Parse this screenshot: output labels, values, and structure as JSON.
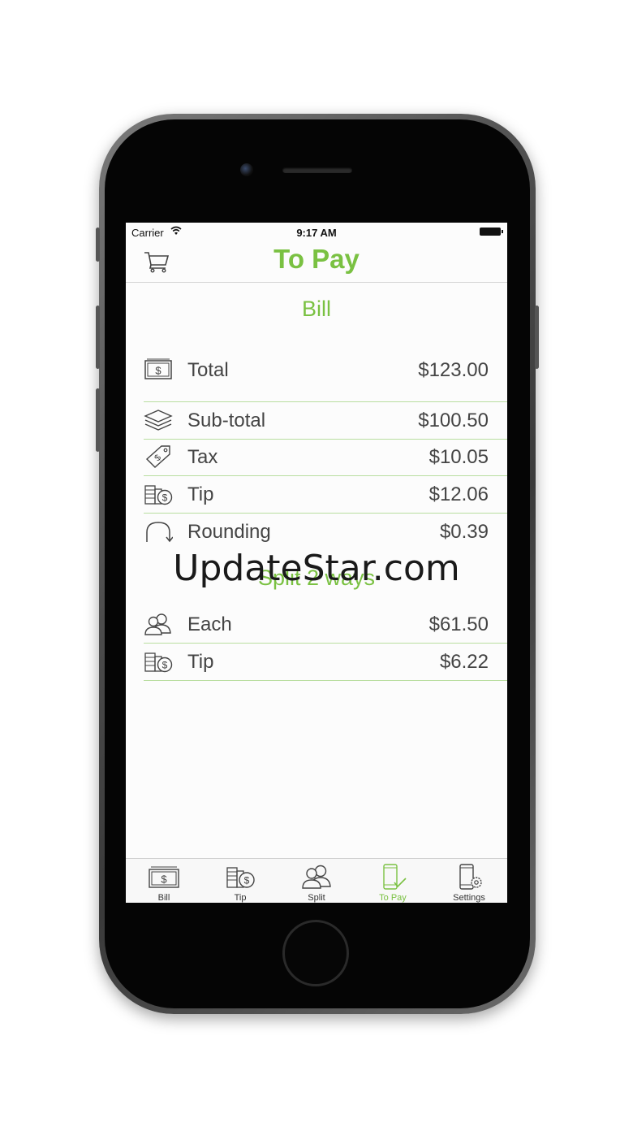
{
  "status_bar": {
    "carrier": "Carrier",
    "time": "9:17 AM"
  },
  "nav": {
    "title": "To Pay",
    "left_icon": "cart-icon"
  },
  "bill": {
    "title": "Bill",
    "total": {
      "label": "Total",
      "value": "$123.00",
      "icon": "cash-icon"
    },
    "rows": [
      {
        "label": "Sub-total",
        "value": "$100.50",
        "icon": "layers-icon"
      },
      {
        "label": "Tax",
        "value": "$10.05",
        "icon": "price-tag-icon"
      },
      {
        "label": "Tip",
        "value": "$12.06",
        "icon": "coins-icon"
      },
      {
        "label": "Rounding",
        "value": "$0.39",
        "icon": "rounding-arrow-icon"
      }
    ]
  },
  "split": {
    "title": "Split 2 ways",
    "rows": [
      {
        "label": "Each",
        "value": "$61.50",
        "icon": "users-icon"
      },
      {
        "label": "Tip",
        "value": "$6.22",
        "icon": "coins-icon"
      }
    ]
  },
  "tabs": [
    {
      "label": "Bill",
      "icon": "cash-icon"
    },
    {
      "label": "Tip",
      "icon": "coins-icon"
    },
    {
      "label": "Split",
      "icon": "users-icon"
    },
    {
      "label": "To Pay",
      "icon": "phone-check-icon",
      "active": true
    },
    {
      "label": "Settings",
      "icon": "phone-gear-icon"
    }
  ],
  "watermark": "UpdateStar.com",
  "colors": {
    "accent": "#7ac142",
    "divider": "#b9dea0",
    "text": "#444444"
  }
}
